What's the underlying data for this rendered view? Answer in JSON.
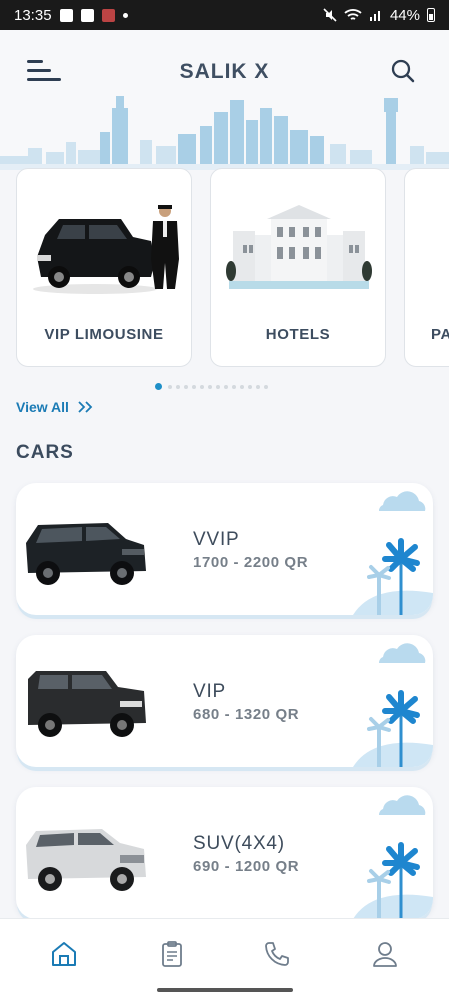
{
  "status_bar": {
    "time": "13:35",
    "battery": "44%"
  },
  "header": {
    "title": "SALIK X"
  },
  "categories": [
    {
      "label": "VIP LIMOUSINE",
      "icon": "limousine-image"
    },
    {
      "label": "HOTELS",
      "icon": "hotel-image"
    },
    {
      "label": "PA",
      "icon": "partial-card-image"
    }
  ],
  "carousel": {
    "pages": 14,
    "active": 0
  },
  "view_all": "View All",
  "section_title": "CARS",
  "cars": [
    {
      "name": "VVIP",
      "price": "1700 - 2200 QR",
      "car_color": "#1d2226"
    },
    {
      "name": "VIP",
      "price": "680 - 1320 QR",
      "car_color": "#2a2c2e"
    },
    {
      "name": "SUV(4X4)",
      "price": "690 - 1200 QR",
      "car_color": "#d7d9db"
    }
  ],
  "nav": [
    {
      "name": "home",
      "icon": "home-icon",
      "active": true
    },
    {
      "name": "orders",
      "icon": "clipboard-icon",
      "active": false
    },
    {
      "name": "call",
      "icon": "phone-icon",
      "active": false
    },
    {
      "name": "profile",
      "icon": "user-icon",
      "active": false
    }
  ],
  "colors": {
    "accent": "#1b7bb5",
    "title": "#3f4f62",
    "skyline": "#a9cfe6",
    "deco": "#7fb9dd"
  }
}
